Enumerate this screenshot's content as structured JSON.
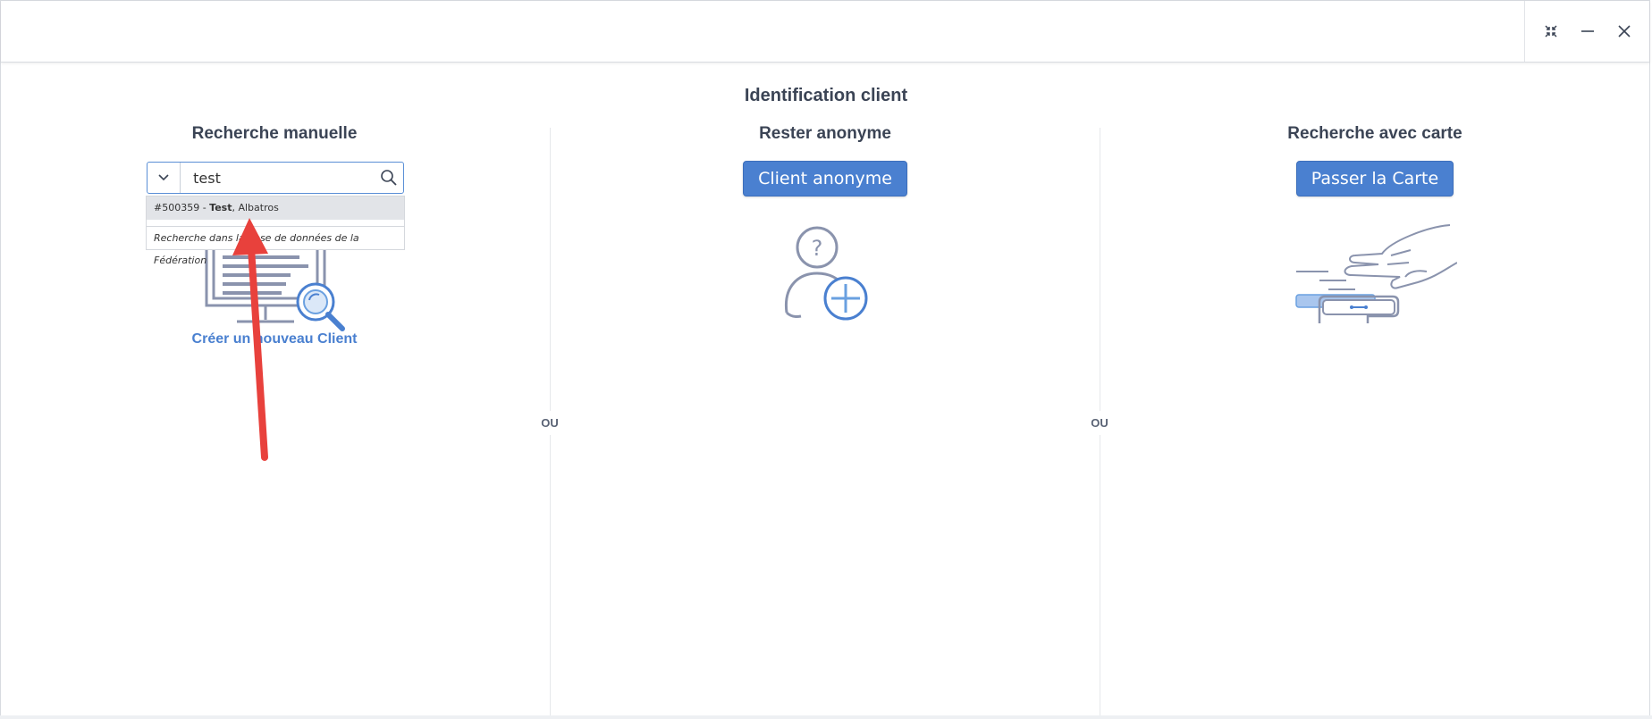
{
  "window": {
    "controls": [
      "fullscreen-exit-icon",
      "minimize-icon",
      "close-icon"
    ]
  },
  "page": {
    "title": "Identification client",
    "separator": "OU"
  },
  "manual_search": {
    "heading": "Recherche manuelle",
    "input_value": "test",
    "results": [
      {
        "id": "#500359 - ",
        "lastname": "Test",
        "rest": ", Albatros"
      }
    ],
    "federation_search": "Recherche dans la base de données de la Fédération",
    "create_link": "Créer un nouveau Client"
  },
  "anonymous": {
    "heading": "Rester anonyme",
    "button": "Client anonyme"
  },
  "card": {
    "heading": "Recherche avec carte",
    "button": "Passer la Carte"
  },
  "colors": {
    "primary": "#4a80d0",
    "text": "#3b4455",
    "annotation_arrow": "#e8413c"
  }
}
